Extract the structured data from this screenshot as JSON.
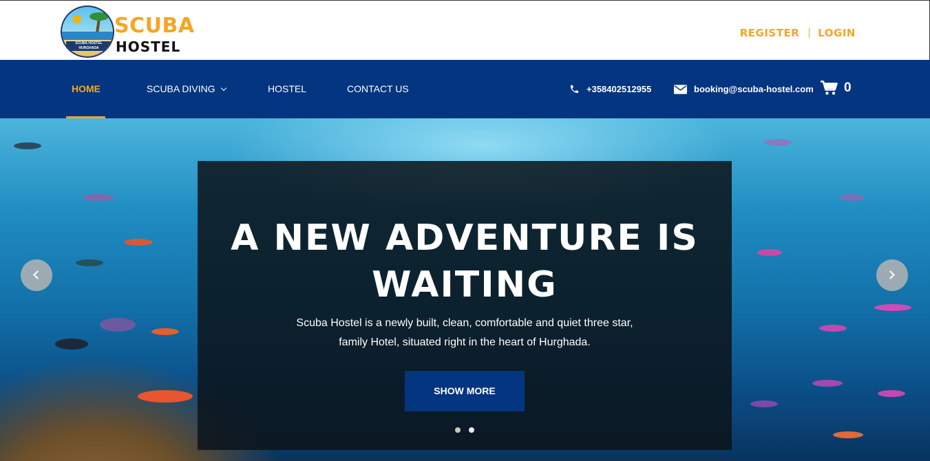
{
  "brand": {
    "name_line1": "SCUBA",
    "name_line2": "HOSTEL",
    "badge_text": "SCUBA HOSTEL HURGHADA",
    "accent_color": "#f5a623",
    "nav_color": "#043580"
  },
  "auth": {
    "register_label": "REGISTER",
    "login_label": "LOGIN"
  },
  "nav": {
    "items": [
      {
        "label": "HOME",
        "active": true
      },
      {
        "label": "SCUBA DIVING",
        "has_dropdown": true
      },
      {
        "label": "HOSTEL"
      },
      {
        "label": "CONTACT US"
      }
    ],
    "phone": "+358402512955",
    "email": "booking@scuba-hostel.com",
    "cart_count": "0"
  },
  "hero": {
    "title_line1": "A NEW ADVENTURE IS",
    "title_line2": "WAITING",
    "text_line1": "Scuba Hostel is a newly built, clean, comfortable and quiet three star,",
    "text_line2": "family Hotel, situated right in the heart of Hurghada.",
    "button_label": "SHOW MORE",
    "slides": 2,
    "active_slide": 2
  },
  "icons": {
    "phone": "phone-icon",
    "email": "envelope-icon",
    "cart": "cart-icon",
    "prev": "chevron-left-icon",
    "next": "chevron-right-icon"
  }
}
